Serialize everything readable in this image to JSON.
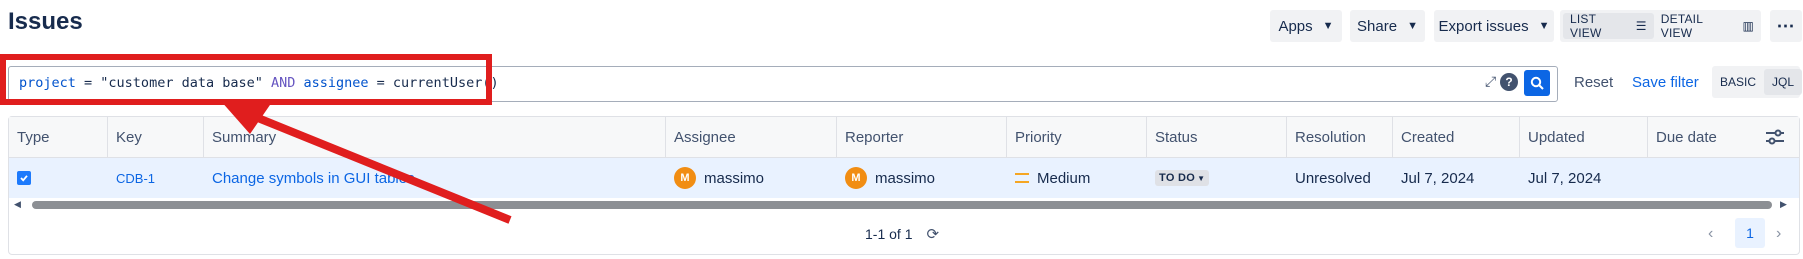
{
  "header": {
    "title": "Issues",
    "apps_label": "Apps",
    "share_label": "Share",
    "export_label": "Export issues",
    "list_view_label": "LIST VIEW",
    "detail_view_label": "DETAIL VIEW"
  },
  "query": {
    "tokens": {
      "f1": "project",
      "eq1": " = ",
      "v1": "\"customer data base\"",
      "and": " AND ",
      "f2": "assignee",
      "eq2": " = ",
      "v2": "currentUser()"
    },
    "help": "?",
    "reset_label": "Reset",
    "save_label": "Save filter",
    "basic_label": "BASIC",
    "jql_label": "JQL"
  },
  "table": {
    "columns": [
      "Type",
      "Key",
      "Summary",
      "Assignee",
      "Reporter",
      "Priority",
      "Status",
      "Resolution",
      "Created",
      "Updated",
      "Due date"
    ],
    "row": {
      "key": "CDB-1",
      "summary": "Change symbols in GUI tables",
      "assignee_initial": "M",
      "assignee": "massimo",
      "reporter_initial": "M",
      "reporter": "massimo",
      "priority": "Medium",
      "status": "TO DO",
      "resolution": "Unresolved",
      "created": "Jul 7, 2024",
      "updated": "Jul 7, 2024",
      "due": ""
    }
  },
  "pagination": {
    "summary": "1-1 of 1",
    "current_page": "1"
  },
  "colors": {
    "accent": "#0c66e4",
    "annotation_red": "#e01e1e",
    "priority_medium": "#f5a623",
    "avatar": "#f18d13"
  }
}
